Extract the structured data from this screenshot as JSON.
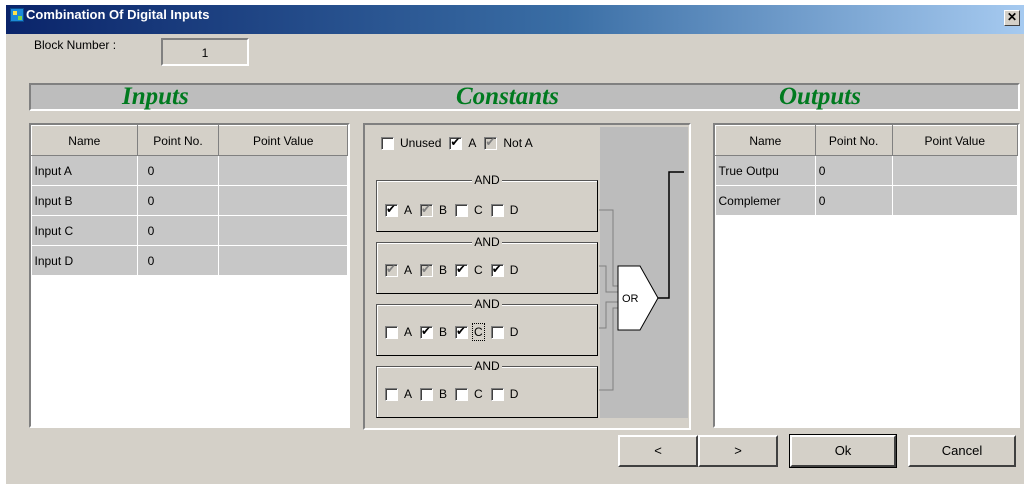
{
  "window": {
    "title": "Combination Of Digital Inputs",
    "close_symbol": "✕"
  },
  "block_number": {
    "label": "Block Number :",
    "value": "1"
  },
  "sections": {
    "inputs": "Inputs",
    "constants": "Constants",
    "outputs": "Outputs"
  },
  "inputs_table": {
    "columns": [
      "Name",
      "Point No.",
      "Point Value"
    ],
    "rows": [
      {
        "name": "Input A",
        "point_no": "0",
        "point_value": ""
      },
      {
        "name": "Input B",
        "point_no": "0",
        "point_value": ""
      },
      {
        "name": "Input C",
        "point_no": "0",
        "point_value": ""
      },
      {
        "name": "Input D",
        "point_no": "0",
        "point_value": ""
      }
    ]
  },
  "constants": {
    "top": [
      {
        "label": "Unused",
        "checked": false,
        "disabled": false
      },
      {
        "label": "A",
        "checked": true,
        "disabled": false
      },
      {
        "label": "Not A",
        "checked": true,
        "disabled": true
      }
    ],
    "groups": [
      {
        "label": "AND",
        "items": [
          {
            "label": "A",
            "checked": true,
            "disabled": false
          },
          {
            "label": "B",
            "checked": true,
            "disabled": true
          },
          {
            "label": "C",
            "checked": false,
            "disabled": false
          },
          {
            "label": "D",
            "checked": false,
            "disabled": false
          }
        ]
      },
      {
        "label": "AND",
        "items": [
          {
            "label": "A",
            "checked": true,
            "disabled": true
          },
          {
            "label": "B",
            "checked": true,
            "disabled": true
          },
          {
            "label": "C",
            "checked": true,
            "disabled": false
          },
          {
            "label": "D",
            "checked": true,
            "disabled": false
          }
        ]
      },
      {
        "label": "AND",
        "items": [
          {
            "label": "A",
            "checked": false,
            "disabled": false
          },
          {
            "label": "B",
            "checked": true,
            "disabled": false
          },
          {
            "label": "C",
            "checked": true,
            "disabled": false,
            "focused": true
          },
          {
            "label": "D",
            "checked": false,
            "disabled": false
          }
        ]
      },
      {
        "label": "AND",
        "items": [
          {
            "label": "A",
            "checked": false,
            "disabled": false
          },
          {
            "label": "B",
            "checked": false,
            "disabled": false
          },
          {
            "label": "C",
            "checked": false,
            "disabled": false
          },
          {
            "label": "D",
            "checked": false,
            "disabled": false
          }
        ]
      }
    ],
    "or_gate_label": "OR"
  },
  "outputs_table": {
    "columns": [
      "Name",
      "Point No.",
      "Point Value"
    ],
    "rows": [
      {
        "name": "True Outpu",
        "point_no": "0",
        "point_value": ""
      },
      {
        "name": "Complemer",
        "point_no": "0",
        "point_value": ""
      }
    ]
  },
  "buttons": {
    "prev": "<",
    "next": ">",
    "ok": "Ok",
    "cancel": "Cancel"
  },
  "colors": {
    "heading": "#007a1f",
    "title_bar": "#0a246a",
    "dialog_bg": "#d4d0c8"
  }
}
